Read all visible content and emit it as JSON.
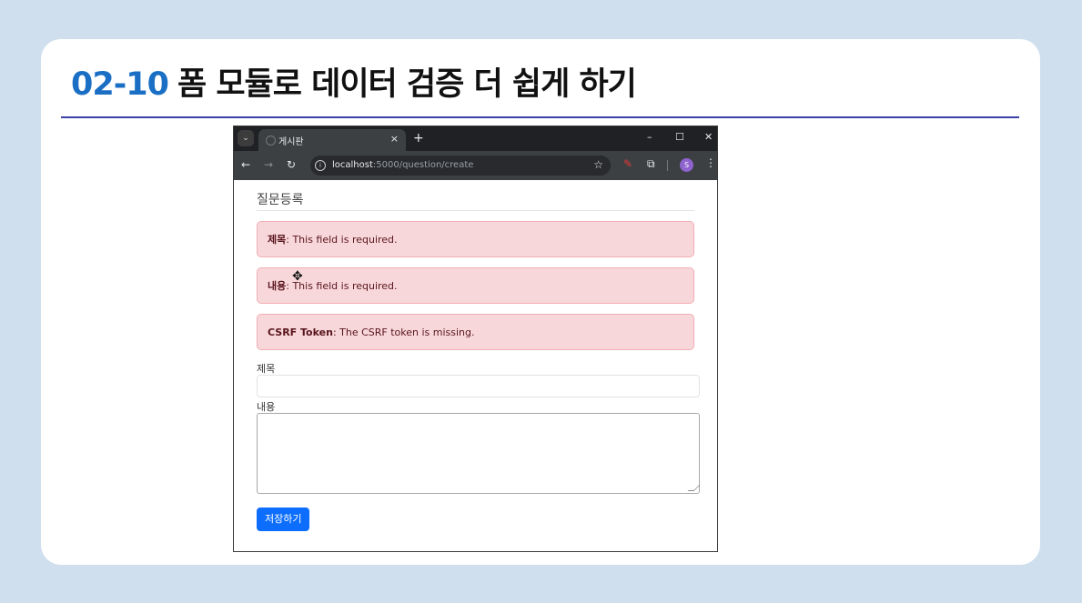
{
  "slide": {
    "number": "02-10",
    "title": "폼 모듈로 데이터 검증 더 쉽게 하기"
  },
  "browser": {
    "tab_title": "게시판",
    "tab_close": "×",
    "new_tab": "+",
    "minimize": "–",
    "maximize": "☐",
    "close": "✕",
    "url_host": "localhost",
    "url_path": ":5000/question/create",
    "profile_initial": "S"
  },
  "page": {
    "title": "질문등록",
    "errors": [
      {
        "field": "제목",
        "message": ": This field is required."
      },
      {
        "field": "내용",
        "message": ": This field is required."
      },
      {
        "field": "CSRF Token",
        "message": ": The CSRF token is missing."
      }
    ],
    "subject_label": "제목",
    "subject_value": "",
    "content_label": "내용",
    "content_value": "",
    "submit_label": "저장하기"
  },
  "colors": {
    "accent": "#1a6fc4",
    "alert_bg": "#f8d7da",
    "primary_button": "#0d6efd"
  }
}
